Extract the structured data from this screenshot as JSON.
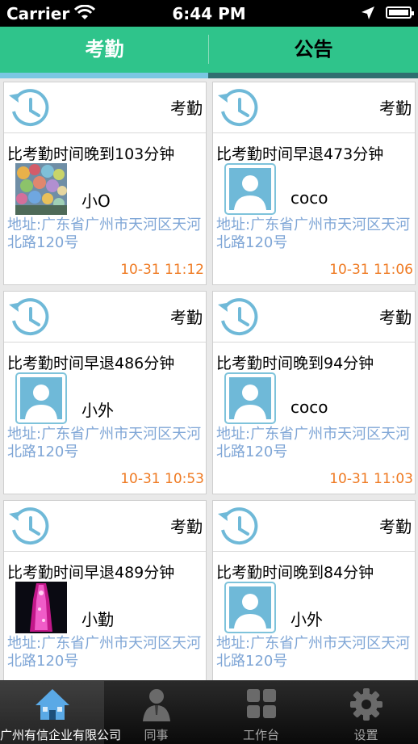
{
  "status_bar": {
    "carrier": "Carrier",
    "time": "6:44 PM"
  },
  "tabs": [
    {
      "label": "考勤",
      "active": true
    },
    {
      "label": "公告",
      "active": false
    }
  ],
  "records": [
    {
      "type": "考勤",
      "message": "比考勤时间晚到103分钟",
      "name": "小O",
      "avatar": "photo-balloons",
      "address": "地址:广东省广州市天河区天河北路120号",
      "time": "10-31 11:12"
    },
    {
      "type": "考勤",
      "message": "比考勤时间早退473分钟",
      "name": "coco",
      "avatar": "default-person-icon",
      "address": "地址:广东省广州市天河区天河北路120号",
      "time": "10-31 11:06"
    },
    {
      "type": "考勤",
      "message": "比考勤时间早退486分钟",
      "name": "小外",
      "avatar": "default-person-icon",
      "address": "地址:广东省广州市天河区天河北路120号",
      "time": "10-31 10:53"
    },
    {
      "type": "考勤",
      "message": "比考勤时间晚到94分钟",
      "name": "coco",
      "avatar": "default-person-icon",
      "address": "地址:广东省广州市天河区天河北路120号",
      "time": "10-31 11:03"
    },
    {
      "type": "考勤",
      "message": "比考勤时间早退489分钟",
      "name": "小勤",
      "avatar": "photo-tower",
      "address": "地址:广东省广州市天河区天河北路120号",
      "time": ""
    },
    {
      "type": "考勤",
      "message": "比考勤时间晚到84分钟",
      "name": "小外",
      "avatar": "default-person-icon",
      "address": "地址:广东省广州市天河区天河北路120号",
      "time": ""
    }
  ],
  "tab_bar": [
    {
      "label": "广州有信企业有限公司",
      "icon": "home-icon",
      "active": true
    },
    {
      "label": "同事",
      "icon": "person-icon",
      "active": false
    },
    {
      "label": "工作台",
      "icon": "grid-icon",
      "active": false
    },
    {
      "label": "设置",
      "icon": "gear-icon",
      "active": false
    }
  ],
  "colors": {
    "accent": "#2fc48b",
    "address": "#7fa6d6",
    "timestamp": "#ef7a22",
    "clock": "#6fb9d8"
  }
}
